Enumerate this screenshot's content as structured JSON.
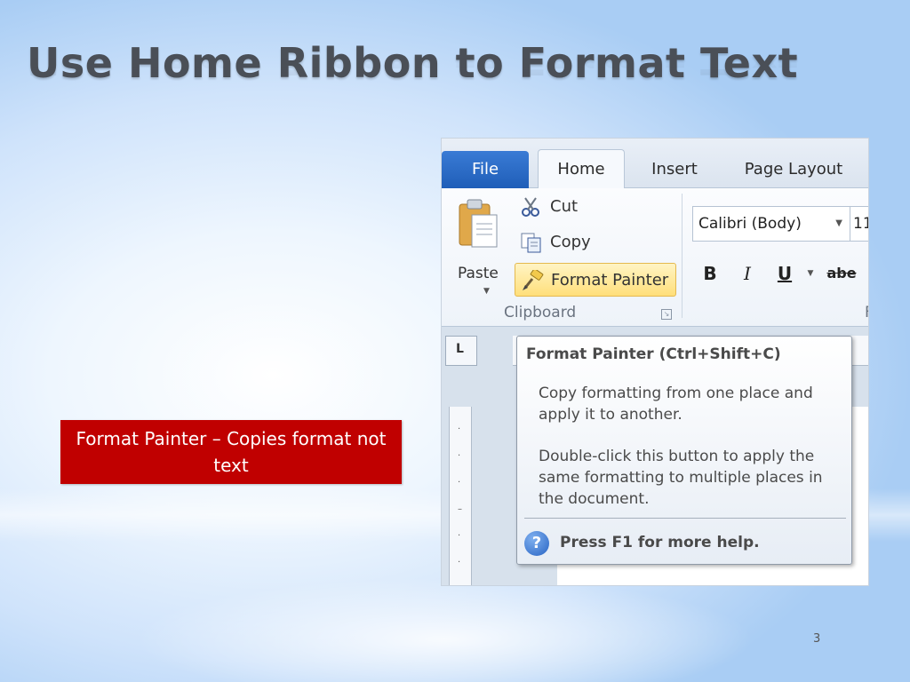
{
  "slide": {
    "title": "Use Home Ribbon to Format Text",
    "callout": "Format Painter – Copies format not text",
    "page_number": "3"
  },
  "ribbon": {
    "tabs": [
      {
        "label": "File"
      },
      {
        "label": "Home"
      },
      {
        "label": "Insert"
      },
      {
        "label": "Page Layout"
      }
    ],
    "clipboard": {
      "paste_label": "Paste",
      "cut_label": "Cut",
      "copy_label": "Copy",
      "format_painter_label": "Format Painter",
      "group_label": "Clipboard"
    },
    "font": {
      "font_name": "Calibri (Body)",
      "font_size": "11",
      "bold_label": "B",
      "italic_label": "I",
      "underline_label": "U",
      "strikethrough_label": "abe",
      "group_label": "F"
    }
  },
  "tooltip": {
    "title": "Format Painter (Ctrl+Shift+C)",
    "body1": "Copy formatting from one place and apply it to another.",
    "body2": "Double-click this button to apply the same formatting to multiple places in the document.",
    "help_icon": "?",
    "help_text": "Press F1 for more help."
  },
  "ruler": {
    "corner_glyph": "L"
  },
  "colors": {
    "callout_bg": "#c00000",
    "file_tab": "#1f5eb8",
    "format_painter_highlight": "#ffdf7a",
    "title_text": "#4a4f57"
  },
  "icons": [
    "paste-icon",
    "scissors-icon",
    "copy-icon",
    "paintbrush-icon",
    "help-icon"
  ]
}
